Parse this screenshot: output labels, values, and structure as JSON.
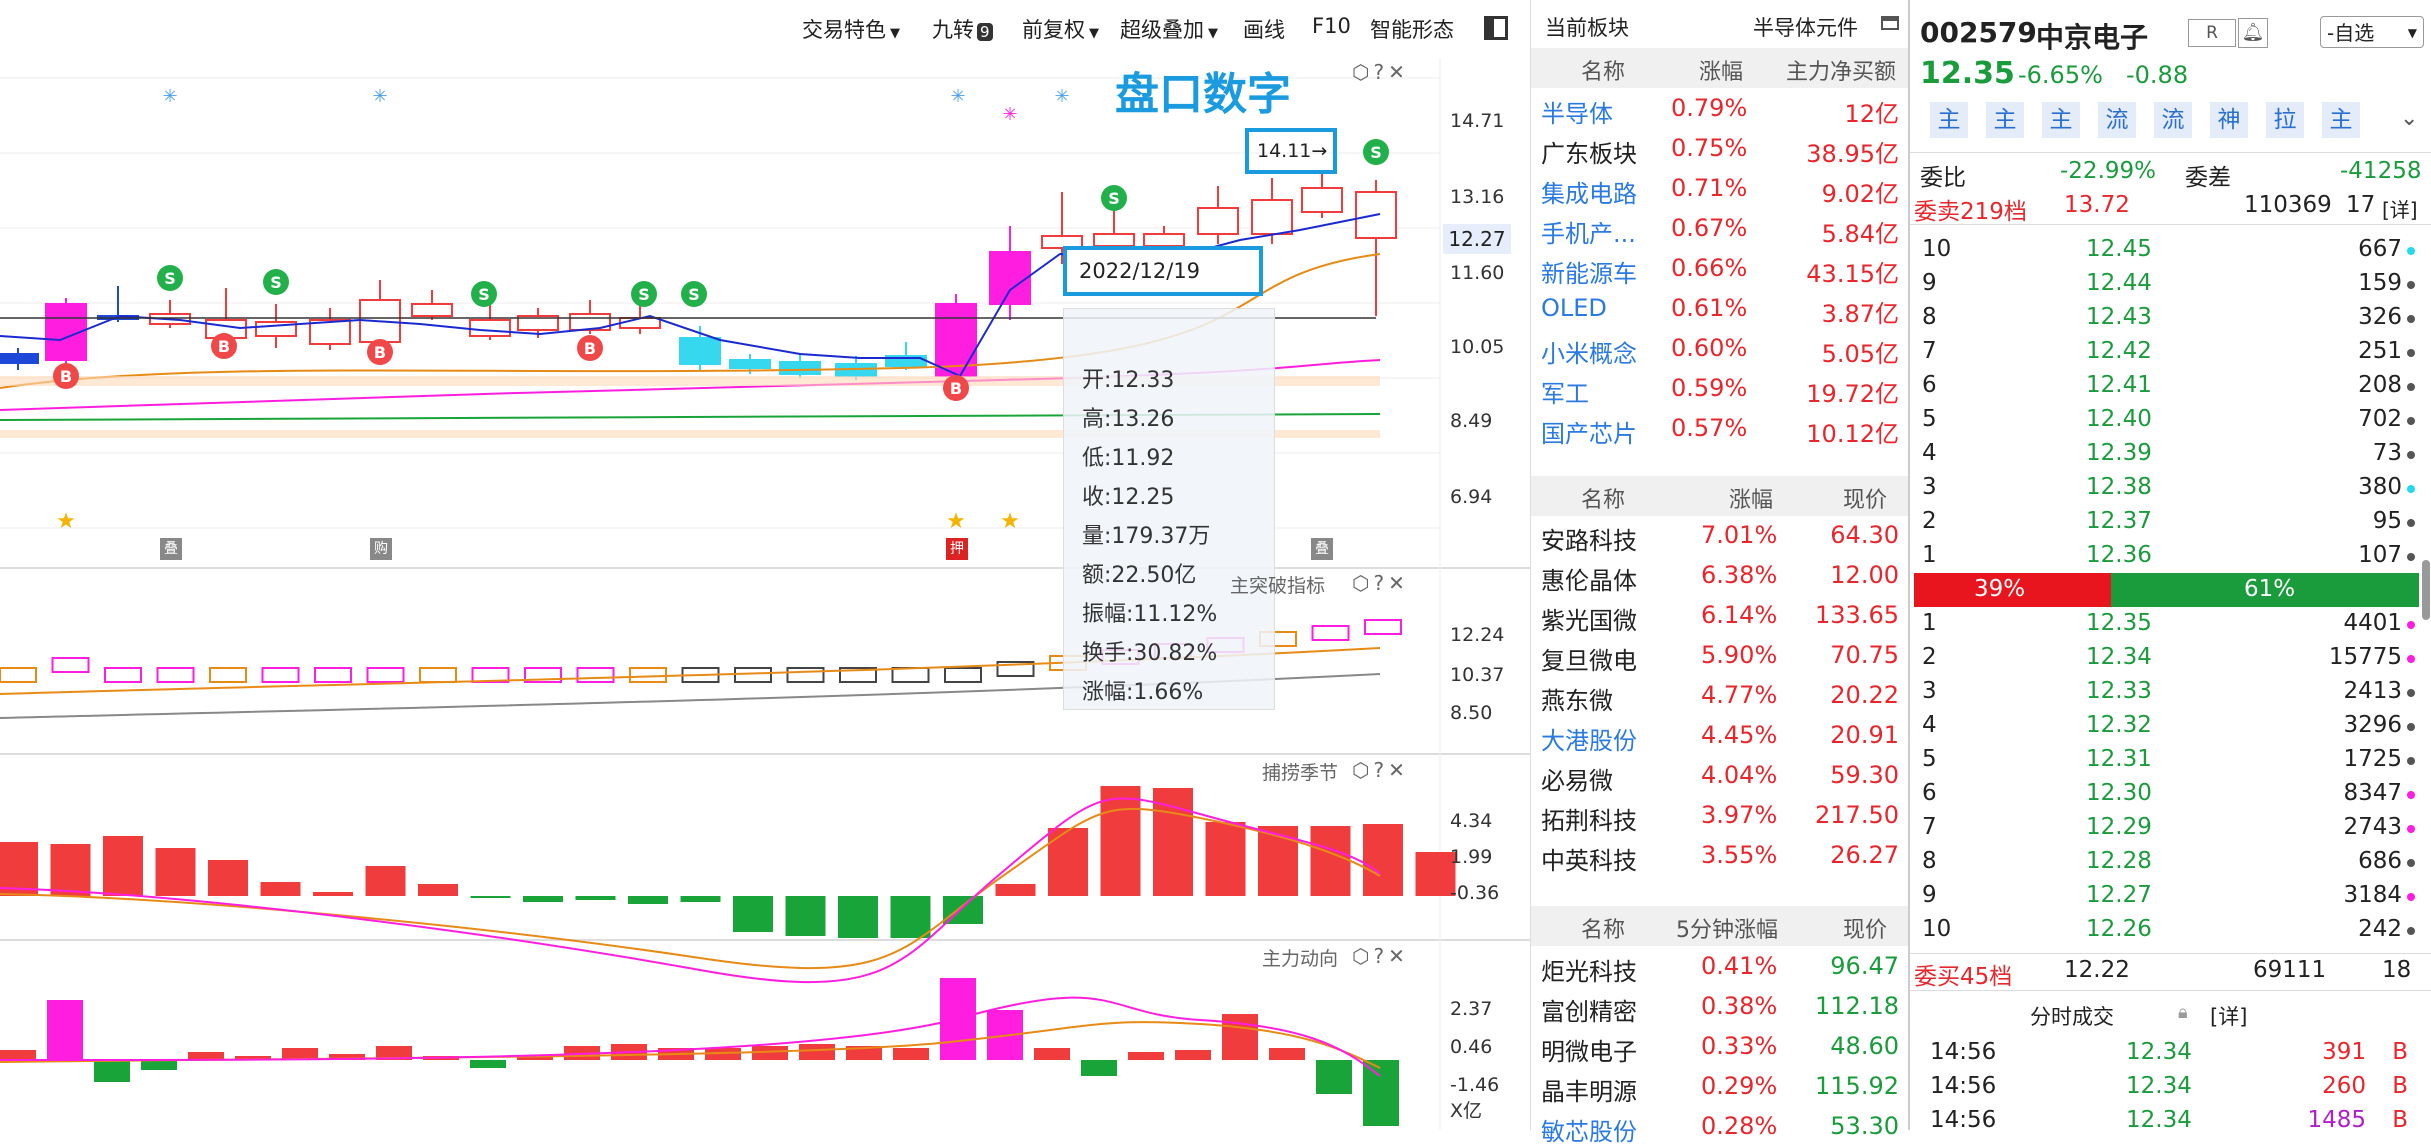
{
  "toolbar": {
    "items": [
      "交易特色",
      "九转",
      "前复权",
      "超级叠加",
      "画线",
      "F10",
      "智能形态"
    ],
    "jiuzhuan_badge": "9"
  },
  "chart": {
    "overlay_title": "盘口数字",
    "main_axis": [
      "14.71",
      "13.16",
      "12.27",
      "11.60",
      "10.05",
      "8.49",
      "6.94"
    ],
    "high_marker": "14.11→",
    "tags": [
      "叠",
      "购",
      "押",
      "叠"
    ],
    "tooltip": {
      "date": "2022/12/19",
      "rows": [
        {
          "label": "开:",
          "value": "12.33"
        },
        {
          "label": "高:",
          "value": "13.26"
        },
        {
          "label": "低:",
          "value": "11.92"
        },
        {
          "label": "收:",
          "value": "12.25"
        },
        {
          "label": "量:",
          "value": "179.37万"
        },
        {
          "label": "额:",
          "value": "22.50亿"
        },
        {
          "label": "振幅:",
          "value": "11.12%"
        },
        {
          "label": "换手:",
          "value": "30.82%"
        },
        {
          "label": "涨幅:",
          "value": "1.66%"
        }
      ]
    },
    "panel2": {
      "title": "主突破指标",
      "axis": [
        "12.24",
        "10.37",
        "8.50"
      ]
    },
    "panel3": {
      "title": "捕捞季节",
      "axis": [
        "4.34",
        "1.99",
        "-0.36"
      ]
    },
    "panel4": {
      "title": "主力动向",
      "axis": [
        "2.37",
        "0.46",
        "-1.46"
      ],
      "unit": "X亿"
    },
    "colors": {
      "red": "#f03c3c",
      "cyan": "#36d8f0",
      "magenta": "#ff1ee0",
      "orange": "#e88a16",
      "green": "#19a43a",
      "blue": "#1a9be0"
    }
  },
  "sector": {
    "header_left": "当前板块",
    "header_right": "半导体元件",
    "table1": {
      "headers": [
        "名称",
        "涨幅",
        "主力净买额"
      ],
      "rows": [
        {
          "name": "半导体",
          "chg": "0.79%",
          "val": "12亿",
          "link": true
        },
        {
          "name": "广东板块",
          "chg": "0.75%",
          "val": "38.95亿",
          "link": false
        },
        {
          "name": "集成电路",
          "chg": "0.71%",
          "val": "9.02亿",
          "link": true
        },
        {
          "name": "手机产...",
          "chg": "0.67%",
          "val": "5.84亿",
          "link": true
        },
        {
          "name": "新能源车",
          "chg": "0.66%",
          "val": "43.15亿",
          "link": true
        },
        {
          "name": "OLED",
          "chg": "0.61%",
          "val": "3.87亿",
          "link": true
        },
        {
          "name": "小米概念",
          "chg": "0.60%",
          "val": "5.05亿",
          "link": true
        },
        {
          "name": "军工",
          "chg": "0.59%",
          "val": "19.72亿",
          "link": true
        },
        {
          "name": "国产芯片",
          "chg": "0.57%",
          "val": "10.12亿",
          "link": true
        }
      ]
    },
    "table2": {
      "headers": [
        "名称",
        "涨幅",
        "现价"
      ],
      "rows": [
        {
          "name": "安路科技",
          "chg": "7.01%",
          "price": "64.30",
          "link": false
        },
        {
          "name": "惠伦晶体",
          "chg": "6.38%",
          "price": "12.00",
          "link": false
        },
        {
          "name": "紫光国微",
          "chg": "6.14%",
          "price": "133.65",
          "link": false
        },
        {
          "name": "复旦微电",
          "chg": "5.90%",
          "price": "70.75",
          "link": false
        },
        {
          "name": "燕东微",
          "chg": "4.77%",
          "price": "20.22",
          "link": false
        },
        {
          "name": "大港股份",
          "chg": "4.45%",
          "price": "20.91",
          "link": true
        },
        {
          "name": "必易微",
          "chg": "4.04%",
          "price": "59.30",
          "link": false
        },
        {
          "name": "拓荆科技",
          "chg": "3.97%",
          "price": "217.50",
          "link": false
        },
        {
          "name": "中英科技",
          "chg": "3.55%",
          "price": "26.27",
          "link": false
        }
      ]
    },
    "table3": {
      "headers": [
        "名称",
        "5分钟涨幅",
        "现价"
      ],
      "rows": [
        {
          "name": "炬光科技",
          "chg": "0.41%",
          "price": "96.47",
          "link": false
        },
        {
          "name": "富创精密",
          "chg": "0.38%",
          "price": "112.18",
          "link": false
        },
        {
          "name": "明微电子",
          "chg": "0.33%",
          "price": "48.60",
          "link": false
        },
        {
          "name": "晶丰明源",
          "chg": "0.29%",
          "price": "115.92",
          "link": false
        },
        {
          "name": "敏芯股份",
          "chg": "0.28%",
          "price": "53.30",
          "link": true
        }
      ]
    }
  },
  "quote": {
    "code": "002579",
    "name": "中京电子",
    "r_badge": "R",
    "watch_button": "-自选",
    "price": "12.35",
    "chg_pct": "-6.65%",
    "chg": "-0.88",
    "flow_buttons": [
      "主",
      "主",
      "主",
      "流",
      "流",
      "神",
      "拉",
      "主"
    ],
    "weibi_label": "委比",
    "weibi": "-22.99%",
    "weicha_label": "委差",
    "weicha": "-41258",
    "sell_total_label": "委卖219档",
    "sell_total_price": "13.72",
    "sell_total_vol": "110369",
    "sell_total_cnt": "17",
    "detail": "[详]",
    "asks": [
      {
        "lvl": "10",
        "price": "12.45",
        "vol": "667",
        "dot": "cyan"
      },
      {
        "lvl": "9",
        "price": "12.44",
        "vol": "159",
        "dot": "gray"
      },
      {
        "lvl": "8",
        "price": "12.43",
        "vol": "326",
        "dot": "gray"
      },
      {
        "lvl": "7",
        "price": "12.42",
        "vol": "251",
        "dot": "gray"
      },
      {
        "lvl": "6",
        "price": "12.41",
        "vol": "208",
        "dot": "gray"
      },
      {
        "lvl": "5",
        "price": "12.40",
        "vol": "702",
        "dot": "gray"
      },
      {
        "lvl": "4",
        "price": "12.39",
        "vol": "73",
        "dot": "gray"
      },
      {
        "lvl": "3",
        "price": "12.38",
        "vol": "380",
        "dot": "cyan"
      },
      {
        "lvl": "2",
        "price": "12.37",
        "vol": "95",
        "dot": "gray"
      },
      {
        "lvl": "1",
        "price": "12.36",
        "vol": "107",
        "dot": "gray"
      }
    ],
    "ratio_sell": "39%",
    "ratio_buy": "61%",
    "ratio_sell_frac": 0.39,
    "bids": [
      {
        "lvl": "1",
        "price": "12.35",
        "vol": "4401",
        "dot": "magenta"
      },
      {
        "lvl": "2",
        "price": "12.34",
        "vol": "15775",
        "dot": "magenta"
      },
      {
        "lvl": "3",
        "price": "12.33",
        "vol": "2413",
        "dot": "gray"
      },
      {
        "lvl": "4",
        "price": "12.32",
        "vol": "3296",
        "dot": "gray"
      },
      {
        "lvl": "5",
        "price": "12.31",
        "vol": "1725",
        "dot": "gray"
      },
      {
        "lvl": "6",
        "price": "12.30",
        "vol": "8347",
        "dot": "magenta"
      },
      {
        "lvl": "7",
        "price": "12.29",
        "vol": "2743",
        "dot": "magenta"
      },
      {
        "lvl": "8",
        "price": "12.28",
        "vol": "686",
        "dot": "gray"
      },
      {
        "lvl": "9",
        "price": "12.27",
        "vol": "3184",
        "dot": "magenta"
      },
      {
        "lvl": "10",
        "price": "12.26",
        "vol": "242",
        "dot": "gray"
      }
    ],
    "buy_total_label": "委买45档",
    "buy_total_price": "12.22",
    "buy_total_vol": "69111",
    "buy_total_cnt": "18",
    "ticks_title": "分时成交",
    "ticks": [
      {
        "time": "14:56",
        "price": "12.34",
        "vol": "391",
        "side": "B"
      },
      {
        "time": "14:56",
        "price": "12.34",
        "vol": "260",
        "side": "B"
      },
      {
        "time": "14:56",
        "price": "12.34",
        "vol": "1485",
        "side": "B"
      }
    ]
  }
}
